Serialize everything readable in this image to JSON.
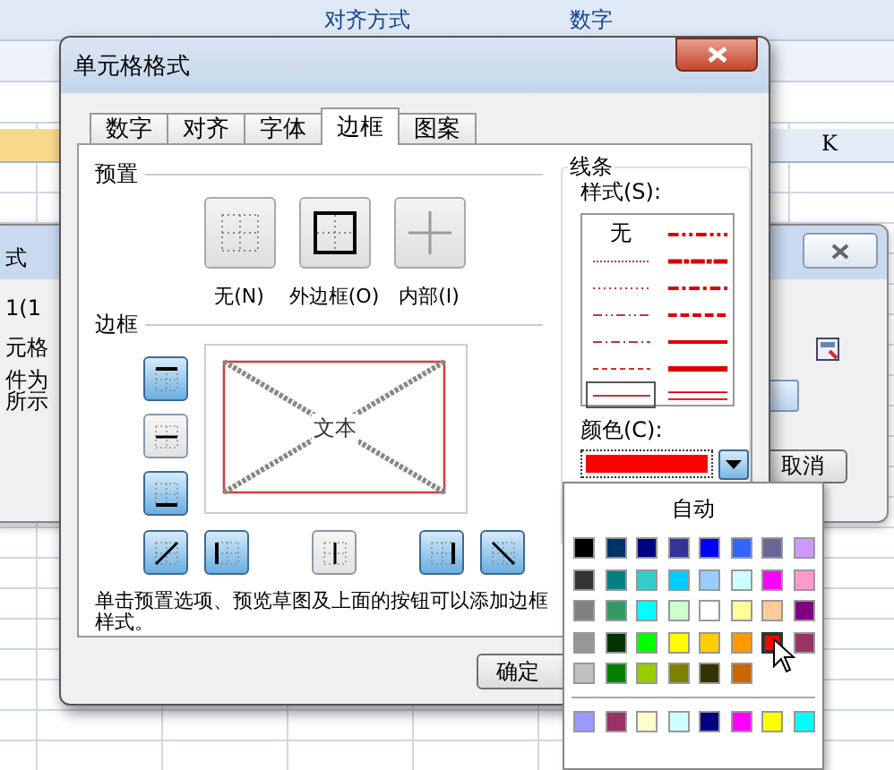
{
  "ribbon": {
    "groups": [
      {
        "label": "对齐方式"
      },
      {
        "label": "数字"
      }
    ]
  },
  "sheet": {
    "column_header": "K"
  },
  "background_dialog": {
    "fragments": [
      "式",
      "1(1",
      "元格",
      "件为",
      "所示"
    ],
    "cancel_button": "取消"
  },
  "dialog": {
    "title": "单元格格式",
    "tabs": [
      {
        "label": "数字",
        "selected": false
      },
      {
        "label": "对齐",
        "selected": false
      },
      {
        "label": "字体",
        "selected": false
      },
      {
        "label": "边框",
        "selected": true
      },
      {
        "label": "图案",
        "selected": false
      }
    ],
    "presets": {
      "label": "预置",
      "items": [
        {
          "kind": "none",
          "label": "无(N)"
        },
        {
          "kind": "outline",
          "label": "外边框(O)"
        },
        {
          "kind": "inside",
          "label": "内部(I)"
        }
      ]
    },
    "border": {
      "label": "边框",
      "preview_text": "文本",
      "side_buttons": [
        {
          "kind": "top",
          "on": true
        },
        {
          "kind": "middle",
          "on": false
        },
        {
          "kind": "bottom",
          "on": true
        }
      ],
      "bottom_buttons": [
        {
          "kind": "diag-up",
          "on": true
        },
        {
          "kind": "left",
          "on": true
        },
        {
          "kind": "center",
          "on": false
        },
        {
          "kind": "right",
          "on": true
        },
        {
          "kind": "diag-down",
          "on": true
        }
      ]
    },
    "hint": "单击预置选项、预览草图及上面的按钮可以添加边框样式。",
    "line": {
      "label": "线条",
      "style_label": "样式(S):",
      "color_label": "颜色(C):",
      "color": "#ff0000",
      "styles": [
        {
          "kind": "none",
          "label": "无",
          "selected": false
        },
        {
          "kind": "hair",
          "selected": false
        },
        {
          "kind": "dotted",
          "selected": false
        },
        {
          "kind": "dash-dot-dot",
          "selected": false
        },
        {
          "kind": "dash-dot",
          "selected": false
        },
        {
          "kind": "dashed",
          "selected": false
        },
        {
          "kind": "thin",
          "selected": true
        },
        {
          "kind": "medium-dash-dot-dot",
          "selected": false
        },
        {
          "kind": "slant-dash-dot",
          "selected": false
        },
        {
          "kind": "medium-dash-dot",
          "selected": false
        },
        {
          "kind": "medium-dashed",
          "selected": false
        },
        {
          "kind": "medium",
          "selected": false
        },
        {
          "kind": "thick",
          "selected": false
        },
        {
          "kind": "double",
          "selected": false
        }
      ]
    },
    "ok_button": "确定"
  },
  "color_menu": {
    "auto_label": "自动",
    "colors": [
      {
        "color": "#000000",
        "selected": false
      },
      {
        "color": "#003366",
        "selected": false
      },
      {
        "color": "#000080",
        "selected": false
      },
      {
        "color": "#333399",
        "selected": false
      },
      {
        "color": "#0000ff",
        "selected": false
      },
      {
        "color": "#3366ff",
        "selected": false
      },
      {
        "color": "#666699",
        "selected": false
      },
      {
        "color": "#cc99ff",
        "selected": false
      },
      {
        "color": "#333333",
        "selected": false
      },
      {
        "color": "#008080",
        "selected": false
      },
      {
        "color": "#33cccc",
        "selected": false
      },
      {
        "color": "#00ccff",
        "selected": false
      },
      {
        "color": "#99ccff",
        "selected": false
      },
      {
        "color": "#ccffff",
        "selected": false
      },
      {
        "color": "#ff00ff",
        "selected": false
      },
      {
        "color": "#ff99cc",
        "selected": false
      },
      {
        "color": "#808080",
        "selected": false
      },
      {
        "color": "#339966",
        "selected": false
      },
      {
        "color": "#00ffff",
        "selected": false
      },
      {
        "color": "#ccffcc",
        "selected": false
      },
      {
        "color": "#ffffff",
        "selected": false
      },
      {
        "color": "#ffff99",
        "selected": false
      },
      {
        "color": "#ffcc99",
        "selected": false
      },
      {
        "color": "#800080",
        "selected": false
      },
      {
        "color": "#969696",
        "selected": false
      },
      {
        "color": "#003300",
        "selected": false
      },
      {
        "color": "#00ff00",
        "selected": false
      },
      {
        "color": "#ffff00",
        "selected": false
      },
      {
        "color": "#ffcc00",
        "selected": false
      },
      {
        "color": "#ff9900",
        "selected": false
      },
      {
        "color": "#ff0000",
        "selected": true
      },
      {
        "color": "#993366",
        "selected": false
      },
      {
        "color": "#c0c0c0",
        "selected": false
      },
      {
        "color": "#008000",
        "selected": false
      },
      {
        "color": "#99cc00",
        "selected": false
      },
      {
        "color": "#808000",
        "selected": false
      },
      {
        "color": "#333300",
        "selected": false
      },
      {
        "color": "#cc6600",
        "selected": false
      }
    ],
    "extra_colors": [
      {
        "color": "#9999ff",
        "selected": false
      },
      {
        "color": "#993366",
        "selected": false
      },
      {
        "color": "#ffffcc",
        "selected": false
      },
      {
        "color": "#ccffff",
        "selected": false
      },
      {
        "color": "#000080",
        "selected": false
      },
      {
        "color": "#ff00ff",
        "selected": false
      },
      {
        "color": "#ffff00",
        "selected": false
      },
      {
        "color": "#00ffff",
        "selected": false
      }
    ]
  }
}
